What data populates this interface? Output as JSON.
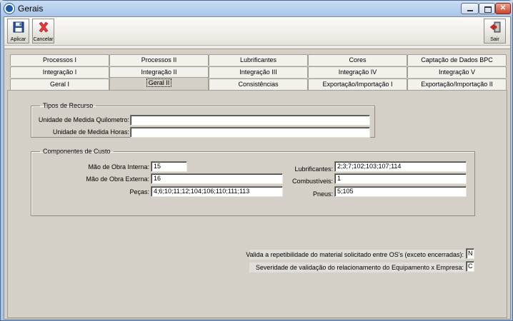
{
  "window": {
    "title": "Gerais"
  },
  "toolbar": {
    "apply_label": "Aplicar",
    "cancel_label": "Cancelar",
    "exit_label": "Sair"
  },
  "tabs": {
    "row1": [
      "Processos I",
      "Processos II",
      "Lubrificantes",
      "Cores",
      "Captação de Dados BPC"
    ],
    "row2": [
      "Integração I",
      "Integração II",
      "Integração III",
      "Integração IV",
      "Integração V"
    ],
    "row3": [
      "Geral I",
      "Geral II",
      "Consistências",
      "Exportação/Importação I",
      "Exportação/Importação II"
    ],
    "active": "Geral II"
  },
  "tipos_recurso": {
    "legend": "Tipos de Recurso",
    "km_label": "Unidade de Medida Quilometro:",
    "km_value": "",
    "horas_label": "Unidade de Medida Horas:",
    "horas_value": ""
  },
  "componentes": {
    "legend": "Componentes de Custo",
    "mo_interna_label": "Mão de Obra Interna:",
    "mo_interna_value": "15",
    "mo_externa_label": "Mão de Obra Externa:",
    "mo_externa_value": "16",
    "pecas_label": "Peças:",
    "pecas_value": "4;6;10;11;12;104;106;110;111;113",
    "lubrificantes_label": "Lubrificantes:",
    "lubrificantes_value": "2;3;7;102;103;107;114",
    "combustiveis_label": "Combustíveis:",
    "combustiveis_value": "1",
    "pneus_label": "Pneus:",
    "pneus_value": "5;105"
  },
  "validacoes": {
    "repetibilidade_label": "Valida a repetibilidade do material solicitado entre OS's (exceto encerradas):",
    "repetibilidade_value": "N",
    "severidade_label": "Severidade de validação do relacionamento do Equipamento x Empresa:",
    "severidade_value": "C"
  }
}
